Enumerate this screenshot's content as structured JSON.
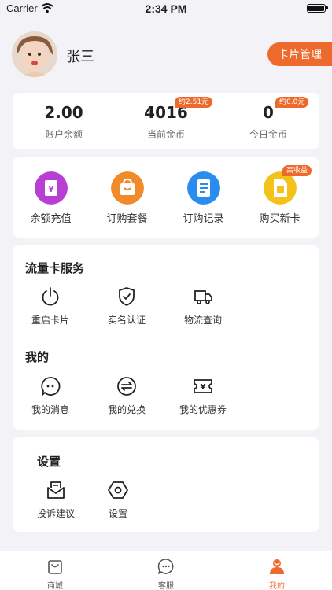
{
  "status_bar": {
    "carrier": "Carrier",
    "time": "2:34 PM"
  },
  "profile": {
    "username": "张三",
    "card_manage_label": "卡片管理"
  },
  "balance": {
    "items": [
      {
        "value": "2.00",
        "label": "账户余额"
      },
      {
        "value": "4016",
        "label": "当前金币",
        "badge": "约2.51元"
      },
      {
        "value": "0",
        "label": "今日金币",
        "badge": "约0.0元"
      }
    ]
  },
  "actions": {
    "items": [
      {
        "label": "余额充值",
        "icon": "wallet-icon",
        "color": "#b83fd4"
      },
      {
        "label": "订购套餐",
        "icon": "shopping-bag-icon",
        "color": "#f08a2a"
      },
      {
        "label": "订购记录",
        "icon": "document-icon",
        "color": "#2b8cf0"
      },
      {
        "label": "购买新卡",
        "icon": "sim-card-icon",
        "color": "#f5c21b",
        "badge": "高收益"
      }
    ]
  },
  "services": {
    "title": "流量卡服务",
    "items": [
      {
        "label": "重启卡片",
        "icon": "power-icon"
      },
      {
        "label": "实名认证",
        "icon": "shield-check-icon"
      },
      {
        "label": "物流查询",
        "icon": "truck-icon"
      }
    ]
  },
  "mine": {
    "title": "我的",
    "items": [
      {
        "label": "我的消息",
        "icon": "message-icon"
      },
      {
        "label": "我的兑换",
        "icon": "exchange-icon"
      },
      {
        "label": "我的优惠券",
        "icon": "coupon-icon"
      }
    ]
  },
  "settings": {
    "title": "设置",
    "items": [
      {
        "label": "投诉建议",
        "icon": "mail-icon"
      },
      {
        "label": "设置",
        "icon": "settings-hex-icon"
      }
    ]
  },
  "tabbar": {
    "items": [
      {
        "label": "商城",
        "icon": "shop-bag-icon"
      },
      {
        "label": "客服",
        "icon": "chat-icon"
      },
      {
        "label": "我的",
        "icon": "user-icon",
        "active": true
      }
    ]
  },
  "colors": {
    "accent": "#ee6a2c",
    "background": "#f3f3f7"
  }
}
